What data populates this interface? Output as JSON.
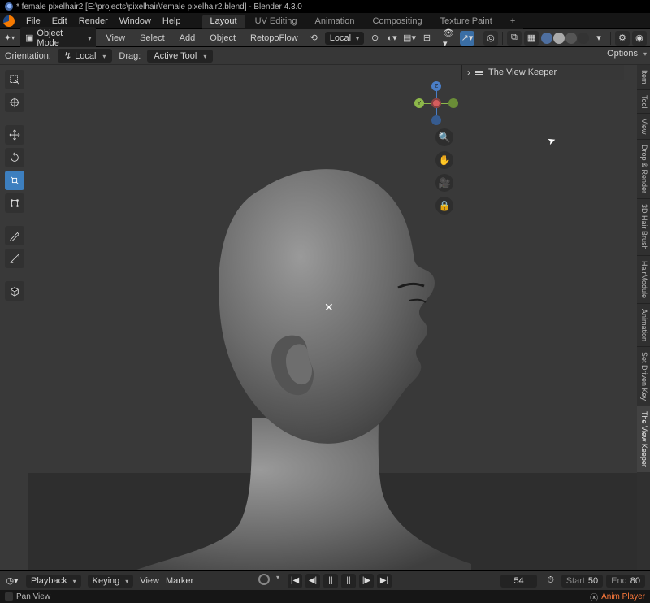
{
  "window": {
    "title": "* female pixelhair2 [E:\\projects\\pixelhair\\female pixelhair2.blend] - Blender 4.3.0"
  },
  "menu": {
    "file": "File",
    "edit": "Edit",
    "render": "Render",
    "window": "Window",
    "help": "Help"
  },
  "workspace_tabs": {
    "layout": "Layout",
    "uv": "UV Editing",
    "animation": "Animation",
    "compositing": "Compositing",
    "texpaint": "Texture Paint",
    "add": "+"
  },
  "header": {
    "mode": "Object Mode",
    "view": "View",
    "select": "Select",
    "add": "Add",
    "object": "Object",
    "retopo": "RetopoFlow",
    "orient": "Local"
  },
  "subheader": {
    "orientation_label": "Orientation:",
    "orientation_value": "Local",
    "drag_label": "Drag:",
    "drag_value": "Active Tool",
    "options": "Options"
  },
  "npanel": {
    "title": "The View Keeper"
  },
  "right_tabs": {
    "item": "Item",
    "tool": "Tool",
    "view": "View",
    "drop": "Drop & Render",
    "hair": "3D Hair Brush",
    "hairmod": "HairModule",
    "anim": "Animation",
    "driven": "Set Driven Key",
    "keeper": "The View Keeper"
  },
  "gizmo": {
    "z": "Z",
    "y": "Y"
  },
  "timeline": {
    "playback": "Playback",
    "keying": "Keying",
    "view": "View",
    "marker": "Marker",
    "frame": "54",
    "start_label": "Start",
    "start": "50",
    "end_label": "End",
    "end": "80"
  },
  "status": {
    "hint": "Pan View",
    "anim": "Anim Player"
  }
}
